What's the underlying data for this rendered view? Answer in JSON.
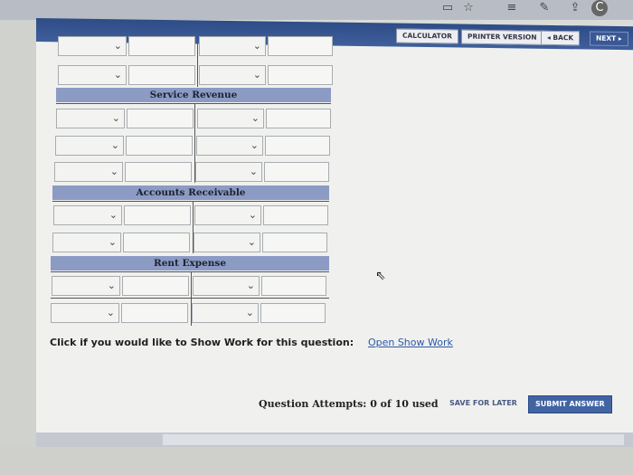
{
  "toolbar": {
    "calculator": "CALCULATOR",
    "printer_version": "PRINTER VERSION",
    "back": "◂ BACK",
    "next": "NEXT ▸"
  },
  "sections": [
    {
      "title": "Service Revenue"
    },
    {
      "title": "Accounts Receivable"
    },
    {
      "title": "Rent Expense"
    }
  ],
  "show_work": {
    "prompt": "Click if you would like to Show Work for this question:",
    "link": "Open Show Work"
  },
  "footer": {
    "attempts": "Question Attempts: 0 of 10 used",
    "save_later": "SAVE FOR LATER",
    "submit": "SUBMIT ANSWER"
  },
  "colors": {
    "toolbar": "#3a5896",
    "section_header": "#8c9bc4",
    "submit": "#4364a3",
    "link": "#2c58a8"
  }
}
